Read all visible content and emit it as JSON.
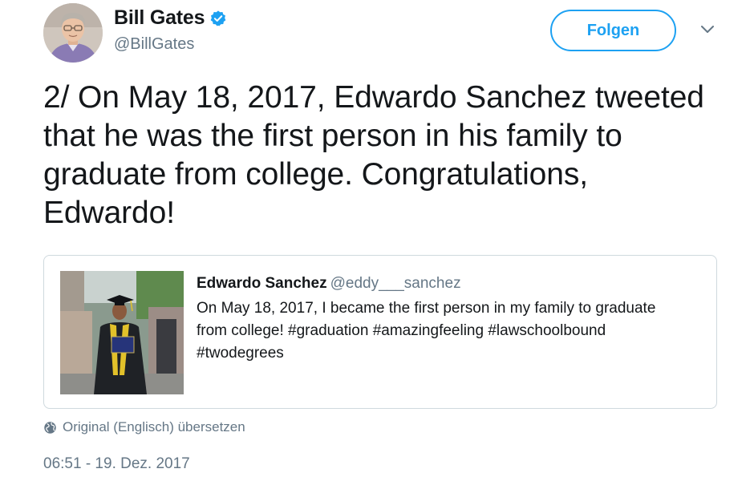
{
  "author": {
    "name": "Bill Gates",
    "handle": "@BillGates",
    "verified": true,
    "avatar": "avatar-photo"
  },
  "actions": {
    "follow_label": "Folgen",
    "more_icon": "chevron-down-icon"
  },
  "tweet": {
    "text": "2/ On May 18, 2017, Edwardo Sanchez tweeted that he was the first person in his family to graduate from college. Congratulations, Edwardo!"
  },
  "quoted_tweet": {
    "name": "Edwardo Sanchez",
    "handle": "@eddy___sanchez",
    "text": "On May 18, 2017, I became the first person in my family to graduate from college! #graduation #amazingfeeling #lawschoolbound #twodegrees",
    "media": "graduation-photo"
  },
  "translate": {
    "icon": "globe-icon",
    "label": "Original (Englisch) übersetzen"
  },
  "timestamp": "06:51 - 19. Dez. 2017",
  "colors": {
    "accent": "#1da1f2",
    "text_primary": "#14171a",
    "text_secondary": "#657786",
    "border": "#cfd9de"
  }
}
